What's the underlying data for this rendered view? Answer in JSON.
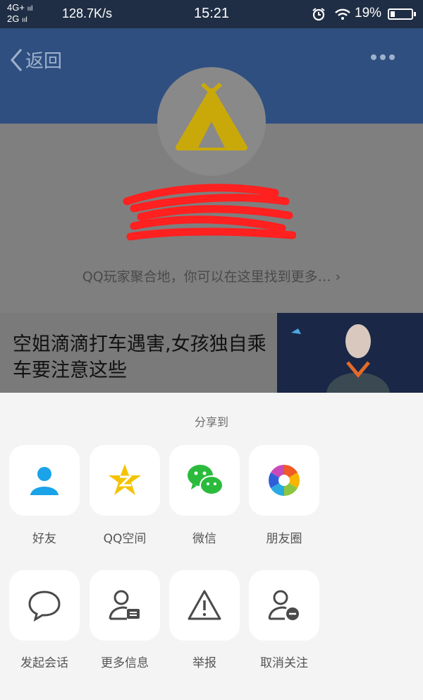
{
  "status_bar": {
    "net_top": "4G+",
    "net_bottom": "2G",
    "speed": "128.7K/s",
    "time": "15:21",
    "battery": "19%"
  },
  "header": {
    "back_label": "返回"
  },
  "profile": {
    "intro": "QQ玩家聚合地，你可以在这里找到更多… ›"
  },
  "news": {
    "title": "空姐滴滴打车遇害,女孩独自乘车要注意这些"
  },
  "share": {
    "heading": "分享到",
    "row1": [
      {
        "label": "好友",
        "icon": "friend-icon"
      },
      {
        "label": "QQ空间",
        "icon": "qzone-icon"
      },
      {
        "label": "微信",
        "icon": "wechat-icon"
      },
      {
        "label": "朋友圈",
        "icon": "moments-icon"
      }
    ],
    "row2": [
      {
        "label": "发起会话",
        "icon": "chat-bubble-icon"
      },
      {
        "label": "更多信息",
        "icon": "profile-card-icon"
      },
      {
        "label": "举报",
        "icon": "warning-icon"
      },
      {
        "label": "取消关注",
        "icon": "unfollow-icon"
      }
    ]
  },
  "colors": {
    "header": "#2f4f80",
    "statusbar": "#1f2e44",
    "avatar_accent": "#c9a90a",
    "wechat_green": "#2bbb3c",
    "qq_blue": "#1aa3e8"
  }
}
